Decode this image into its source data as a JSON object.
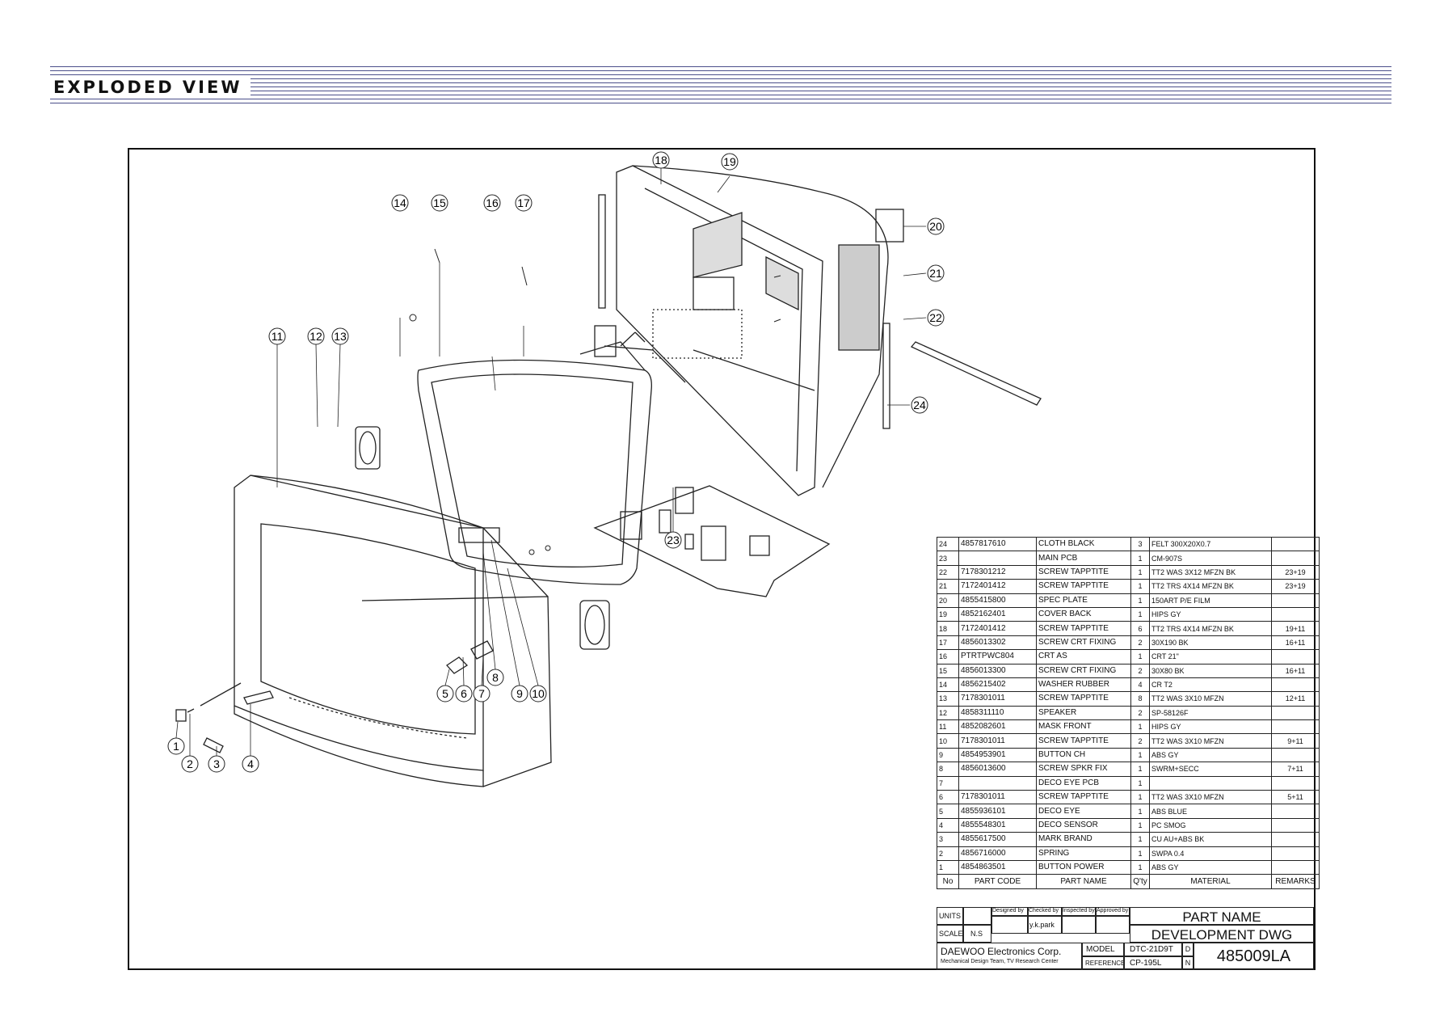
{
  "header": {
    "title": "EXPLODED VIEW"
  },
  "callouts": [
    "1",
    "2",
    "3",
    "4",
    "5",
    "6",
    "7",
    "8",
    "9",
    "10",
    "11",
    "12",
    "13",
    "14",
    "15",
    "16",
    "17",
    "18",
    "19",
    "20",
    "21",
    "22",
    "23",
    "24"
  ],
  "parts_header": {
    "no": "No",
    "code": "PART CODE",
    "name": "PART NAME",
    "qty": "Q'ty",
    "material": "MATERIAL",
    "remarks": "REMARKS"
  },
  "parts": [
    {
      "no": "24",
      "code": "4857817610",
      "name": "CLOTH BLACK",
      "qty": "3",
      "material": "FELT 300X20X0.7",
      "remarks": ""
    },
    {
      "no": "23",
      "code": "",
      "name": "MAIN PCB",
      "qty": "1",
      "material": "CM-907S",
      "remarks": ""
    },
    {
      "no": "22",
      "code": "7178301212",
      "name": "SCREW TAPPTITE",
      "qty": "1",
      "material": "TT2 WAS 3X12 MFZN BK",
      "remarks": "23+19"
    },
    {
      "no": "21",
      "code": "7172401412",
      "name": "SCREW TAPPTITE",
      "qty": "1",
      "material": "TT2 TRS 4X14 MFZN BK",
      "remarks": "23+19"
    },
    {
      "no": "20",
      "code": "4855415800",
      "name": "SPEC PLATE",
      "qty": "1",
      "material": "150ART P/E FILM",
      "remarks": ""
    },
    {
      "no": "19",
      "code": "4852162401",
      "name": "COVER BACK",
      "qty": "1",
      "material": "HIPS GY",
      "remarks": ""
    },
    {
      "no": "18",
      "code": "7172401412",
      "name": "SCREW TAPPTITE",
      "qty": "6",
      "material": "TT2 TRS 4X14 MFZN BK",
      "remarks": "19+11"
    },
    {
      "no": "17",
      "code": "4856013302",
      "name": "SCREW CRT FIXING",
      "qty": "2",
      "material": "30X190 BK",
      "remarks": "16+11"
    },
    {
      "no": "16",
      "code": "PTRTPWC804",
      "name": "CRT AS",
      "qty": "1",
      "material": "CRT 21\"",
      "remarks": ""
    },
    {
      "no": "15",
      "code": "4856013300",
      "name": "SCREW CRT FIXING",
      "qty": "2",
      "material": "30X80 BK",
      "remarks": "16+11"
    },
    {
      "no": "14",
      "code": "4856215402",
      "name": "WASHER RUBBER",
      "qty": "4",
      "material": "CR T2",
      "remarks": ""
    },
    {
      "no": "13",
      "code": "7178301011",
      "name": "SCREW TAPPTITE",
      "qty": "8",
      "material": "TT2 WAS 3X10 MFZN",
      "remarks": "12+11"
    },
    {
      "no": "12",
      "code": "4858311110",
      "name": "SPEAKER",
      "qty": "2",
      "material": "SP-58126F",
      "remarks": ""
    },
    {
      "no": "11",
      "code": "4852082601",
      "name": "MASK FRONT",
      "qty": "1",
      "material": "HIPS GY",
      "remarks": ""
    },
    {
      "no": "10",
      "code": "7178301011",
      "name": "SCREW TAPPTITE",
      "qty": "2",
      "material": "TT2 WAS 3X10 MFZN",
      "remarks": "9+11"
    },
    {
      "no": "9",
      "code": "4854953901",
      "name": "BUTTON CH",
      "qty": "1",
      "material": "ABS GY",
      "remarks": ""
    },
    {
      "no": "8",
      "code": "4856013600",
      "name": "SCREW SPKR FIX",
      "qty": "1",
      "material": "SWRM+SECC",
      "remarks": "7+11"
    },
    {
      "no": "7",
      "code": "",
      "name": "DECO EYE PCB",
      "qty": "1",
      "material": "",
      "remarks": ""
    },
    {
      "no": "6",
      "code": "7178301011",
      "name": "SCREW TAPPTITE",
      "qty": "1",
      "material": "TT2 WAS 3X10 MFZN",
      "remarks": "5+11"
    },
    {
      "no": "5",
      "code": "4855936101",
      "name": "DECO EYE",
      "qty": "1",
      "material": "ABS BLUE",
      "remarks": ""
    },
    {
      "no": "4",
      "code": "4855548301",
      "name": "DECO SENSOR",
      "qty": "1",
      "material": "PC SMOG",
      "remarks": ""
    },
    {
      "no": "3",
      "code": "4855617500",
      "name": "MARK BRAND",
      "qty": "1",
      "material": "CU AU+ABS BK",
      "remarks": ""
    },
    {
      "no": "2",
      "code": "4856716000",
      "name": "SPRING",
      "qty": "1",
      "material": "SWPA 0.4",
      "remarks": ""
    },
    {
      "no": "1",
      "code": "4854863501",
      "name": "BUTTON POWER",
      "qty": "1",
      "material": "ABS GY",
      "remarks": ""
    }
  ],
  "title_block": {
    "units_label": "UNITS",
    "scale_label": "SCALE",
    "scale_value": "N.S",
    "designed_label": "Designed by",
    "checked_label": "Checked by",
    "checked_value": "y.k.park",
    "inspected_label": "Inspected by",
    "approved_label": "Approved by",
    "part_name_label": "PART NAME",
    "drawing_name": "DEVELOPMENT DWG",
    "company": "DAEWOO Electronics Corp.",
    "department": "Mechanical Design Team, TV Research Center",
    "model_label": "MODEL",
    "model_value": "DTC-21D9T",
    "reference_label": "REFERENCE",
    "reference_value": "CP-195L",
    "dn_d": "D",
    "dn_n": "N",
    "drawing_number": "485009LA"
  }
}
